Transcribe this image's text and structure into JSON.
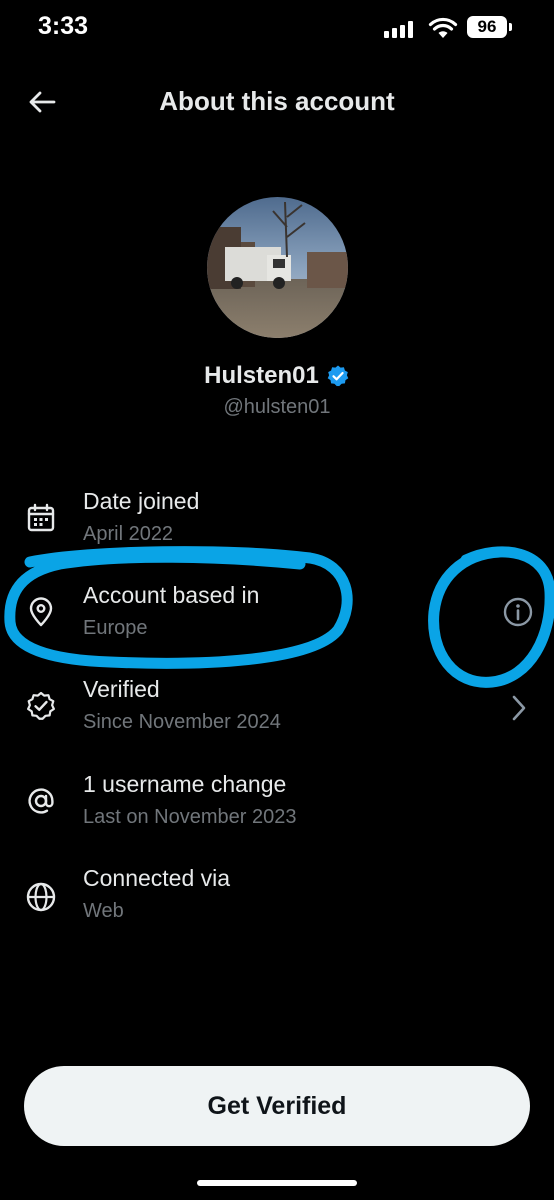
{
  "status_bar": {
    "time": "3:33",
    "battery": "96"
  },
  "header": {
    "title": "About this account"
  },
  "profile": {
    "display_name": "Hulsten01",
    "handle": "@hulsten01",
    "verified_color": "#1d9bf0"
  },
  "rows": [
    {
      "title": "Date joined",
      "subtitle": "April 2022",
      "icon": "calendar-icon"
    },
    {
      "title": "Account based in",
      "subtitle": "Europe",
      "icon": "location-pin-icon",
      "action": "info-icon"
    },
    {
      "title": "Verified",
      "subtitle": "Since November 2024",
      "icon": "verified-check-icon",
      "action": "chevron-right-icon"
    },
    {
      "title": "1 username change",
      "subtitle": "Last on November 2023",
      "icon": "at-sign-icon"
    },
    {
      "title": "Connected via",
      "subtitle": "Web",
      "icon": "globe-icon"
    }
  ],
  "footer": {
    "button_label": "Get Verified"
  },
  "colors": {
    "background": "#000000",
    "primary_text": "#e7e9ea",
    "secondary_text": "#71767b",
    "highlight_marker": "#0aa4e6"
  }
}
